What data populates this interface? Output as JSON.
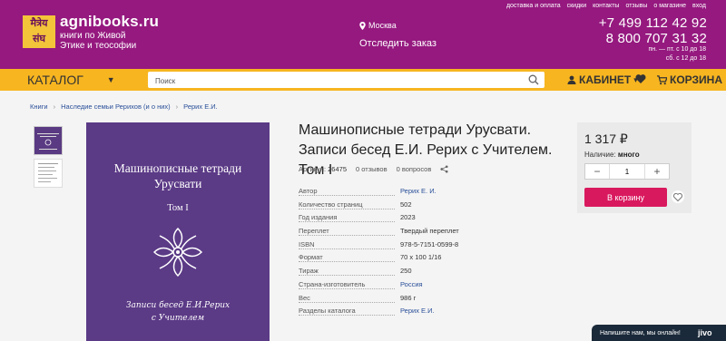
{
  "header": {
    "logo_text": "मैत्रेय संघ",
    "brand": "agnibooks.ru",
    "tagline": "книги по Живой Этике и теософии",
    "city": "Москва",
    "track_order": "Отследить заказ",
    "links": [
      "доставка и оплата",
      "скидки",
      "контакты",
      "отзывы",
      "о магазине",
      "вход"
    ],
    "phone1": "+7 499 112 42 92",
    "phone2": "8 800 707 31 32",
    "hours1": "пн. — пт. с 10 до 18",
    "hours2": "сб. с 12 до 18"
  },
  "nav": {
    "catalog": "КАТАЛОГ",
    "search_placeholder": "Поиск",
    "cabinet": "КАБИНЕТ",
    "cart": "КОРЗИНА"
  },
  "breadcrumbs": [
    "Книги",
    "Наследие семьи Рерихов (и о них)",
    "Рерих Е.И."
  ],
  "cover": {
    "title_line1": "Машинописные тетради",
    "title_line2": "Урусвати",
    "tom": "Том I",
    "sub_line1": "Записи бесед Е.И.Рерих",
    "sub_line2": "с Учителем"
  },
  "product": {
    "title": "Машинописные тетради Урусвати. Записи бесед Е.И. Рерих с Учителем. Том I",
    "article_label": "Артикул:",
    "article": "26475",
    "reviews": "0 отзывов",
    "questions": "0 вопросов",
    "specs": [
      {
        "k": "Автор",
        "v": "Рерих Е. И.",
        "link": true
      },
      {
        "k": "Количество страниц",
        "v": "502",
        "link": false
      },
      {
        "k": "Год издания",
        "v": "2023",
        "link": false
      },
      {
        "k": "Переплет",
        "v": "Твердый переплет",
        "link": false
      },
      {
        "k": "ISBN",
        "v": "978-5-7151-0599-8",
        "link": false
      },
      {
        "k": "Формат",
        "v": "70 х 100 1/16",
        "link": false
      },
      {
        "k": "Тираж",
        "v": "250",
        "link": false
      },
      {
        "k": "Страна-изготовитель",
        "v": "Россия",
        "link": true
      },
      {
        "k": "Вес",
        "v": "986 г",
        "link": false
      },
      {
        "k": "Разделы каталога",
        "v": "Рерих Е.И.",
        "link": true
      }
    ]
  },
  "buy": {
    "price": "1 317 ₽",
    "avail_label": "Наличие:",
    "avail_value": "много",
    "qty": "1",
    "add_to_cart": "В корзину"
  },
  "chat": {
    "text": "Напишите нам, мы онлайн!",
    "brand": "jivo"
  },
  "colors": {
    "header": "#95197f",
    "navbar": "#f7b520",
    "cta": "#d9195e",
    "cover": "#5b3a86"
  }
}
